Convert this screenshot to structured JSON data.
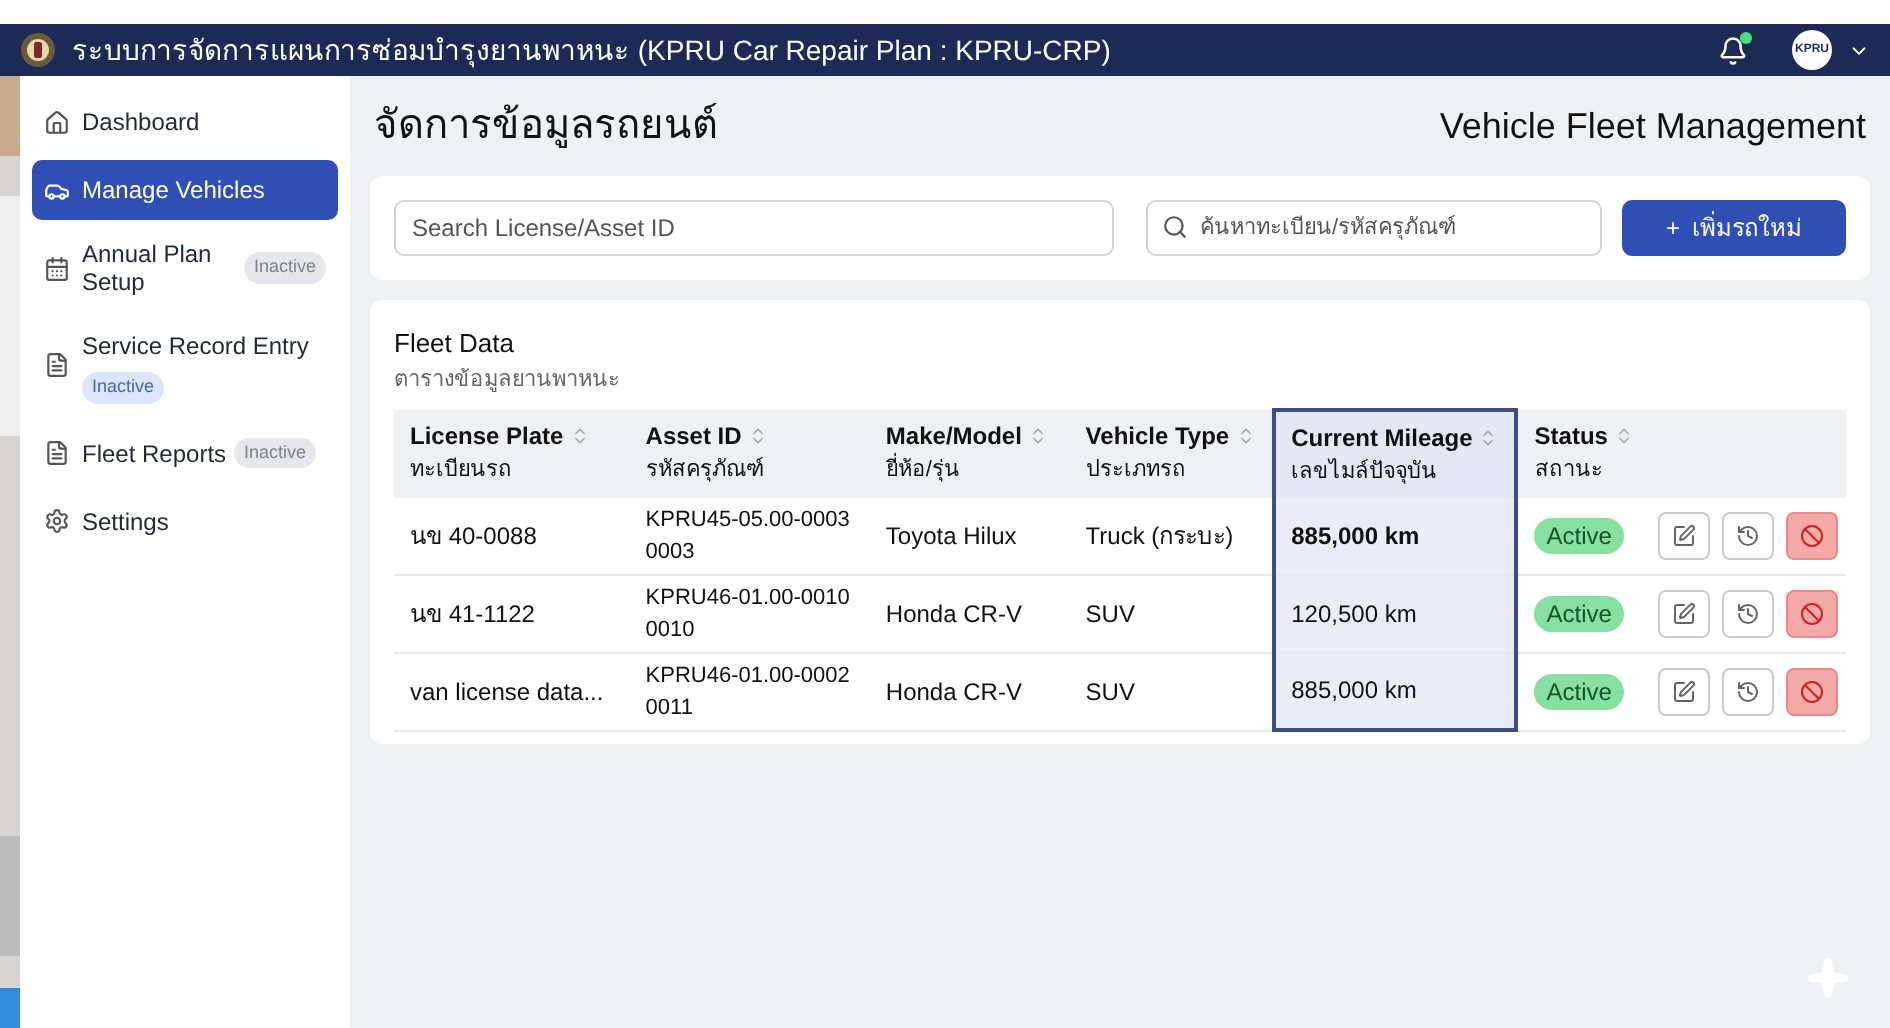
{
  "header": {
    "title": "ระบบการจัดการแผนการซ่อมบำรุงยานพาหนะ (KPRU Car Repair Plan : KPRU-CRP)",
    "notification_dot": true,
    "avatar": "KPRU"
  },
  "sidebar": {
    "items": [
      {
        "label": "Dashboard",
        "selected": false
      },
      {
        "label": "Manage Vehicles",
        "selected": true
      },
      {
        "label": "Annual Plan Setup",
        "selected": false,
        "badge": "Inactive",
        "badge_highlighted": false
      },
      {
        "label": "Service Record Entry",
        "selected": false,
        "badge": "Inactive",
        "badge_highlighted": true
      },
      {
        "label": "Fleet Reports",
        "selected": false,
        "badge": "Inactive",
        "badge_highlighted": false
      },
      {
        "label": "Settings",
        "selected": false
      }
    ]
  },
  "page": {
    "title": "จัดการข้อมูลรถยนต์",
    "subtitle": "Vehicle Fleet Management"
  },
  "search": {
    "placeholder": "Search License/Asset ID",
    "thai_placeholder": "ค้นหาทะเบียน/รหัสครุภัณฑ์",
    "add_button": "เพิ่มรถใหม่",
    "add_icon": "+"
  },
  "table": {
    "title": "Fleet Data",
    "subtitle": "ตารางข้อมูลยานพาหนะ",
    "columns": [
      {
        "label": "License Plate",
        "thai": "ทะเบียนรถ",
        "highlighted": false
      },
      {
        "label": "Asset ID",
        "thai": "รหัสครุภัณฑ์",
        "highlighted": false
      },
      {
        "label": "Make/Model",
        "thai": "ยี่ห้อ/รุ่น",
        "highlighted": false
      },
      {
        "label": "Vehicle Type",
        "thai": "ประเภทรถ",
        "highlighted": false
      },
      {
        "label": "Current Mileage",
        "thai": "เลขไมล์ปัจจุบัน",
        "highlighted": true
      },
      {
        "label": "Status",
        "thai": "สถานะ",
        "highlighted": false
      }
    ],
    "rows": [
      {
        "plate": "นข 40-0088",
        "asset": "KPRU45-05.00-0003 0003",
        "model": "Toyota Hilux",
        "type": "Truck (กระบะ)",
        "mileage": "885,000 km",
        "mileage_bold": true,
        "status": "Active"
      },
      {
        "plate": "นข 41-1122",
        "asset": "KPRU46-01.00-0010 0010",
        "model": "Honda CR-V",
        "type": "SUV",
        "mileage": "120,500 km",
        "mileage_bold": false,
        "status": "Active"
      },
      {
        "plate": "van license data...",
        "asset": "KPRU46-01.00-0002 0011",
        "model": "Honda CR-V",
        "type": "SUV",
        "mileage": "885,000 km",
        "mileage_bold": false,
        "status": "Active"
      }
    ]
  }
}
